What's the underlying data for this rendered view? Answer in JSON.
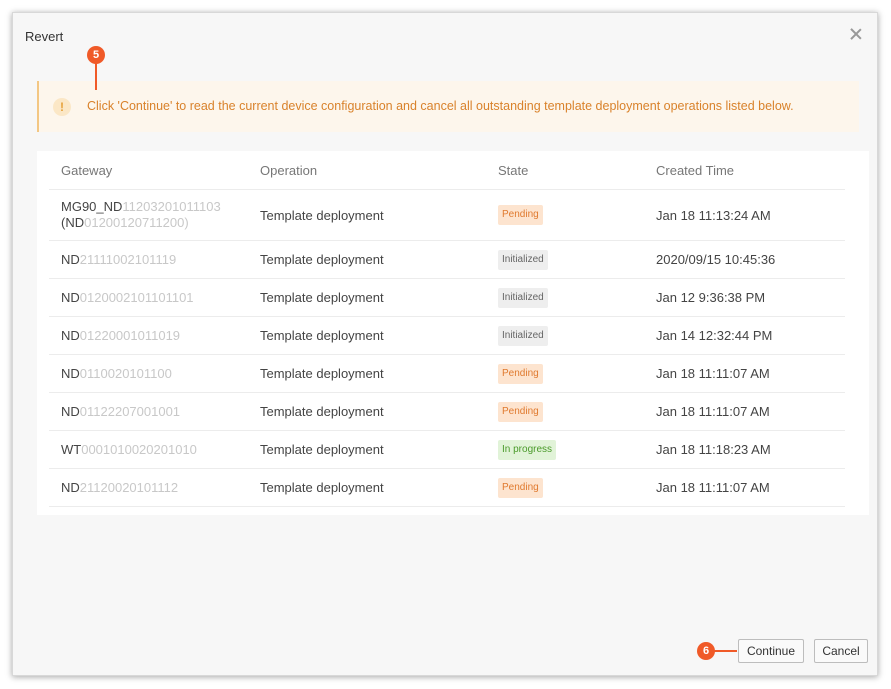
{
  "dialog": {
    "title": "Revert",
    "warning_icon": "!",
    "warning_text": "Click 'Continue' to read the current device configuration and cancel all outstanding template deployment operations listed below."
  },
  "callouts": {
    "step5": "5",
    "step6": "6"
  },
  "table": {
    "headers": [
      "Gateway",
      "Operation",
      "State",
      "Created Time"
    ],
    "rows": [
      {
        "gateway_prefix": "MG90_ND",
        "gateway_obscured": "11203201011103",
        "gateway_line2_prefix": "(ND",
        "gateway_line2_obscured": "01200120711200)",
        "operation": "Template deployment",
        "state": "Pending",
        "created": "Jan 18 11:13:24 AM"
      },
      {
        "gateway_prefix": "ND",
        "gateway_obscured": "21111002101119",
        "operation": "Template deployment",
        "state": "Initialized",
        "created": "2020/09/15 10:45:36"
      },
      {
        "gateway_prefix": "ND",
        "gateway_obscured": "0120002101101101",
        "operation": "Template deployment",
        "state": "Initialized",
        "created": "Jan 12 9:36:38 PM"
      },
      {
        "gateway_prefix": "ND",
        "gateway_obscured": "01220001011019",
        "operation": "Template deployment",
        "state": "Initialized",
        "created": "Jan 14 12:32:44 PM"
      },
      {
        "gateway_prefix": "ND",
        "gateway_obscured": "0110020101100",
        "operation": "Template deployment",
        "state": "Pending",
        "created": "Jan 18 11:11:07 AM"
      },
      {
        "gateway_prefix": "ND",
        "gateway_obscured": "01122207001001",
        "operation": "Template deployment",
        "state": "Pending",
        "created": "Jan 18 11:11:07 AM"
      },
      {
        "gateway_prefix": "WT",
        "gateway_obscured": "0001010020201010",
        "operation": "Template deployment",
        "state": "In progress",
        "created": "Jan 18 11:18:23 AM"
      },
      {
        "gateway_prefix": "ND",
        "gateway_obscured": "21120020101112",
        "operation": "Template deployment",
        "state": "Pending",
        "created": "Jan 18 11:11:07 AM"
      }
    ]
  },
  "buttons": {
    "continue": "Continue",
    "cancel": "Cancel"
  },
  "colors": {
    "accent": "#f05a28",
    "warning_text": "#d9822b",
    "warning_bg": "#fdf6ec",
    "pending": "#e07a2f",
    "in_progress": "#4a9a2a"
  }
}
